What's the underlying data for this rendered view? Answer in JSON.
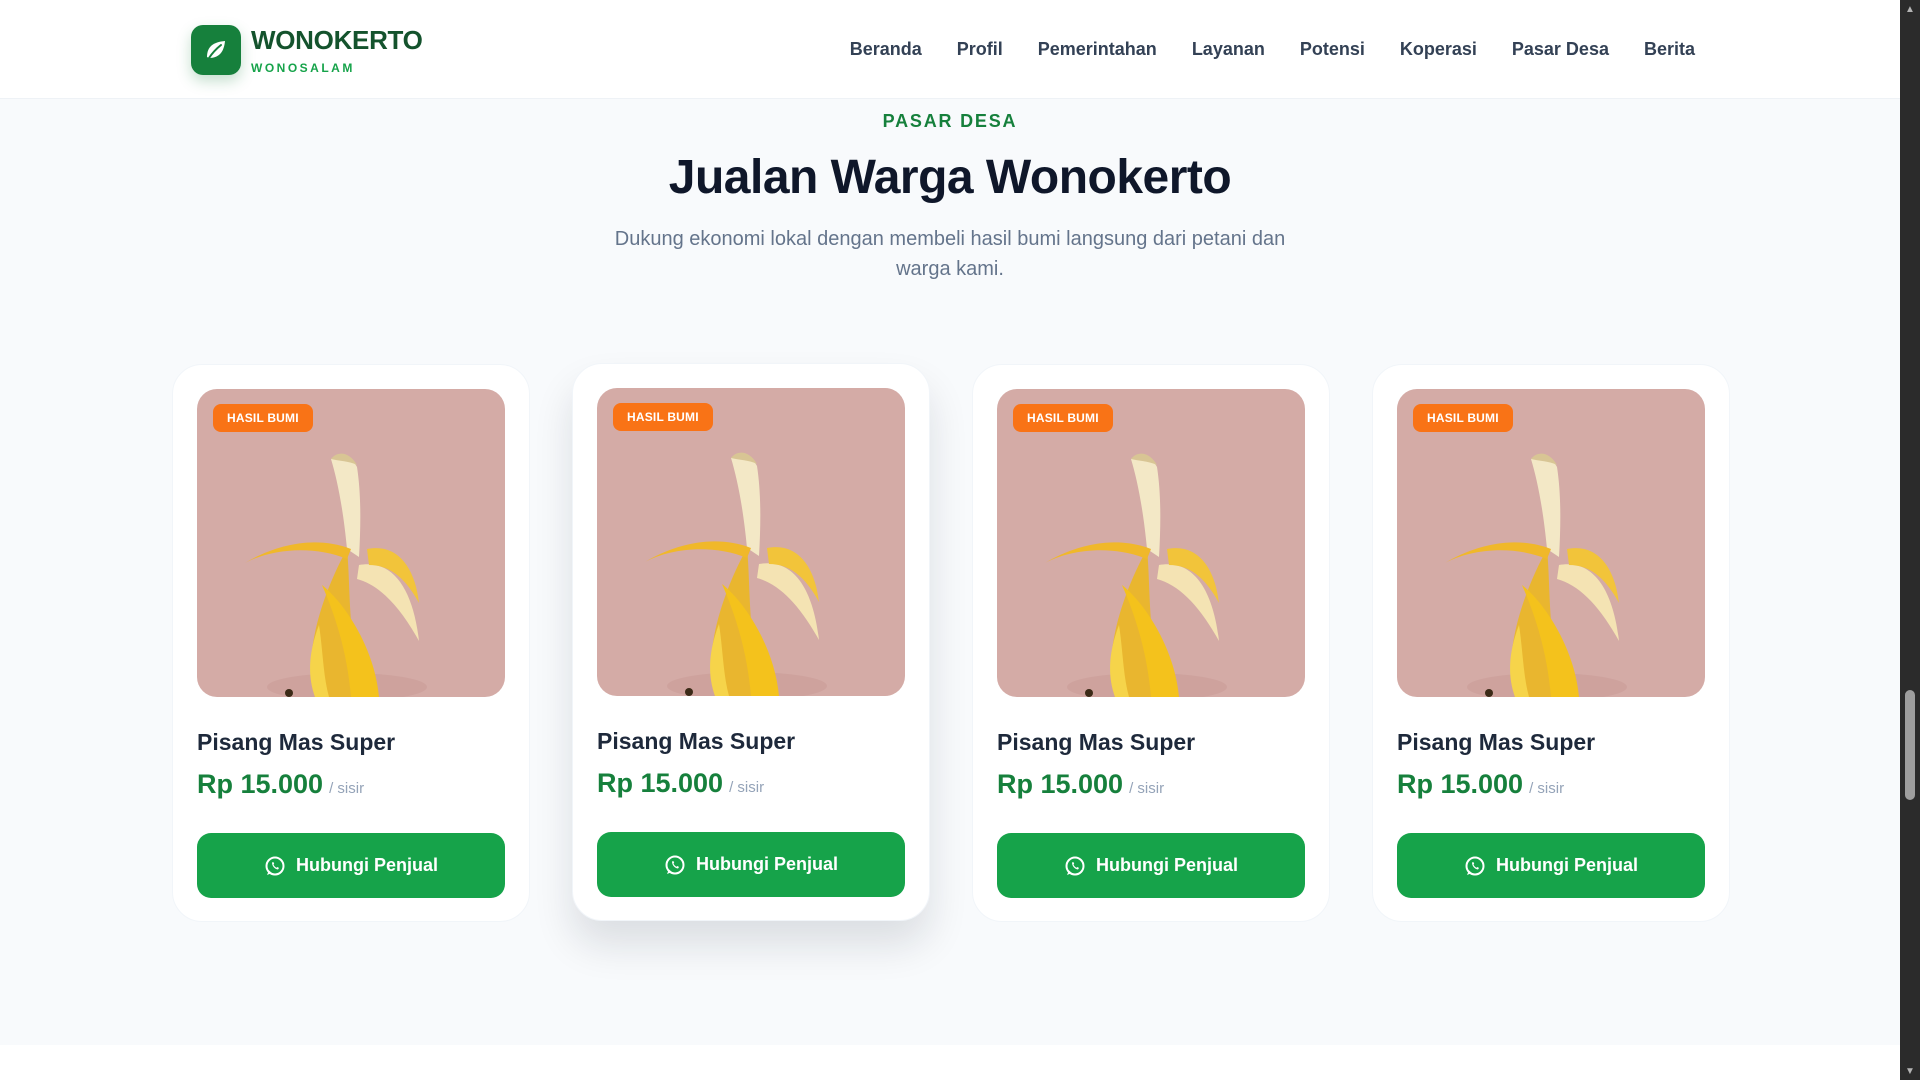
{
  "brand": {
    "name": "WONOKERTO",
    "subtitle": "WONOSALAM",
    "logo_icon": "leaf-icon",
    "color": "#16803c"
  },
  "nav": {
    "items": [
      {
        "label": "Beranda"
      },
      {
        "label": "Profil"
      },
      {
        "label": "Pemerintahan"
      },
      {
        "label": "Layanan"
      },
      {
        "label": "Potensi"
      },
      {
        "label": "Koperasi"
      },
      {
        "label": "Pasar Desa"
      },
      {
        "label": "Berita"
      }
    ]
  },
  "section": {
    "eyebrow": "PASAR DESA",
    "title": "Jualan Warga Wonokerto",
    "subtitle": "Dukung ekonomi lokal dengan membeli hasil bumi langsung dari petani dan warga kami."
  },
  "products": [
    {
      "badge": "HASIL BUMI",
      "name": "Pisang Mas Super",
      "price": "Rp 15.000",
      "unit": "/ sisir",
      "button": "Hubungi Penjual",
      "image": "banana-image"
    },
    {
      "badge": "HASIL BUMI",
      "name": "Pisang Mas Super",
      "price": "Rp 15.000",
      "unit": "/ sisir",
      "button": "Hubungi Penjual",
      "image": "banana-image"
    },
    {
      "badge": "HASIL BUMI",
      "name": "Pisang Mas Super",
      "price": "Rp 15.000",
      "unit": "/ sisir",
      "button": "Hubungi Penjual",
      "image": "banana-image"
    },
    {
      "badge": "HASIL BUMI",
      "name": "Pisang Mas Super",
      "price": "Rp 15.000",
      "unit": "/ sisir",
      "button": "Hubungi Penjual",
      "image": "banana-image"
    }
  ],
  "colors": {
    "accent": "#16a34a",
    "badge": "#f97316",
    "image_bg": "#d4aba6"
  }
}
